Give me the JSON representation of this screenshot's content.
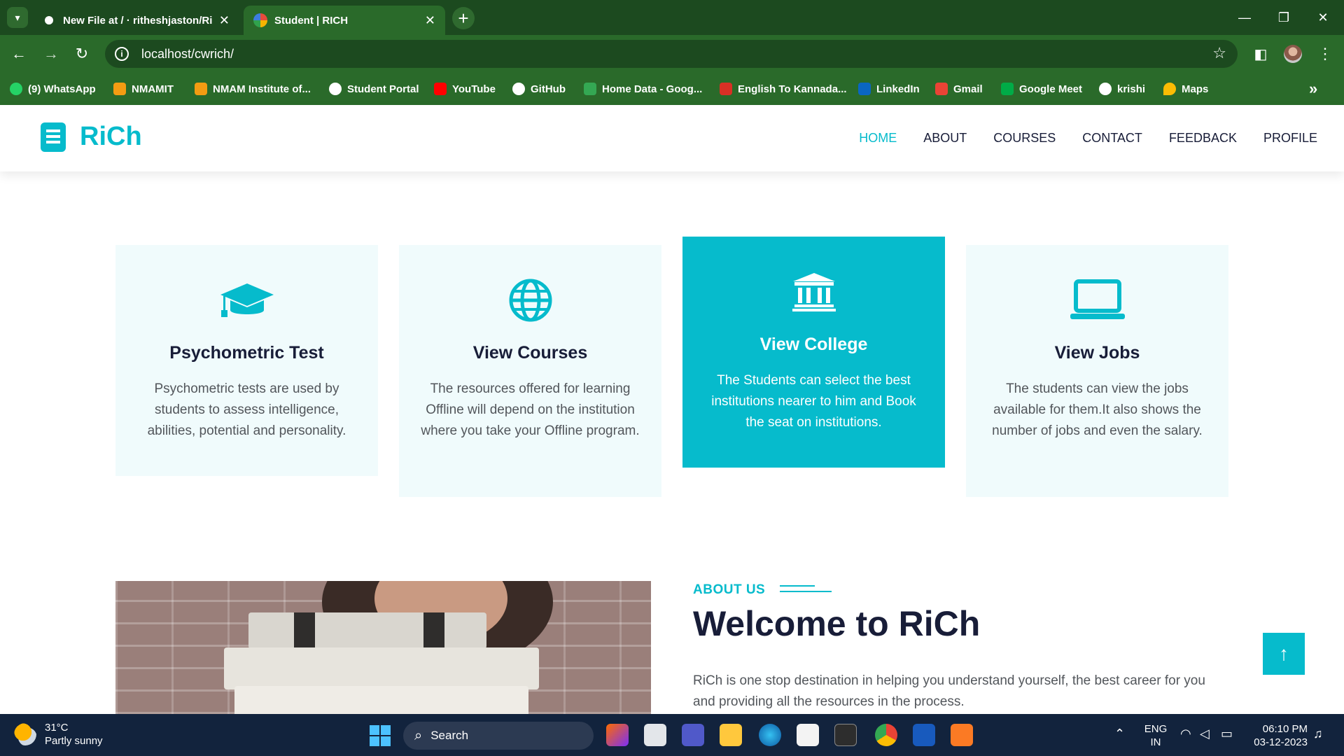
{
  "browser": {
    "tabs": [
      {
        "title": "New File at / · ritheshjaston/Ri",
        "close": "✕"
      },
      {
        "title": "Student | RICH",
        "close": "✕"
      }
    ],
    "new_tab": "+",
    "window_controls": {
      "minimize": "—",
      "maximize": "❐",
      "close": "✕"
    },
    "url": "localhost/cwrich/",
    "bookmarks": [
      {
        "label": "(9) WhatsApp",
        "color": "#25d366"
      },
      {
        "label": "NMAMIT",
        "color": "#f39c12"
      },
      {
        "label": "NMAM Institute of...",
        "color": "#f39c12"
      },
      {
        "label": "Student Portal",
        "color": "#ffffff"
      },
      {
        "label": "YouTube",
        "color": "#ff0000"
      },
      {
        "label": "GitHub",
        "color": "#ffffff"
      },
      {
        "label": "Home Data - Goog...",
        "color": "#34a853"
      },
      {
        "label": "English To Kannada...",
        "color": "#d93025"
      },
      {
        "label": "LinkedIn",
        "color": "#0a66c2"
      },
      {
        "label": "Gmail",
        "color": "#ea4335"
      },
      {
        "label": "Google Meet",
        "color": "#00ac47"
      },
      {
        "label": "krishi",
        "color": "#ffffff"
      },
      {
        "label": "Maps",
        "color": "#fbbc04"
      }
    ],
    "bookmarks_more": "»"
  },
  "site": {
    "logo": "RiCh",
    "nav": [
      "HOME",
      "ABOUT",
      "COURSES",
      "CONTACT",
      "FEEDBACK",
      "PROFILE"
    ],
    "active_nav": "HOME",
    "accent_color": "#06bbcc"
  },
  "cards": [
    {
      "title": "Psychometric Test",
      "text": "Psychometric tests are used by students to assess intelligence, abilities, potential and personality.",
      "icon": "graduation-cap-icon"
    },
    {
      "title": "View Courses",
      "text": "The resources offered for learning Offline will depend on the institution where you take your Offline program.",
      "icon": "globe-icon"
    },
    {
      "title": "View College",
      "text": "The Students can select the best institutions nearer to him and Book the seat on institutions.",
      "icon": "university-icon"
    },
    {
      "title": "View Jobs",
      "text": "The students can view the jobs available for them.It also shows the number of jobs and even the salary.",
      "icon": "laptop-icon"
    }
  ],
  "about": {
    "eyebrow": "ABOUT US",
    "title": "Welcome to RiCh",
    "text": "RiCh is one stop destination in helping you understand yourself, the best career for you and providing all the resources in the process."
  },
  "back_to_top": "↑",
  "taskbar": {
    "weather_temp": "31°C",
    "weather_desc": "Partly sunny",
    "search_label": "Search",
    "lang_1": "ENG",
    "lang_2": "IN",
    "time": "06:10 PM",
    "date": "03-12-2023"
  }
}
